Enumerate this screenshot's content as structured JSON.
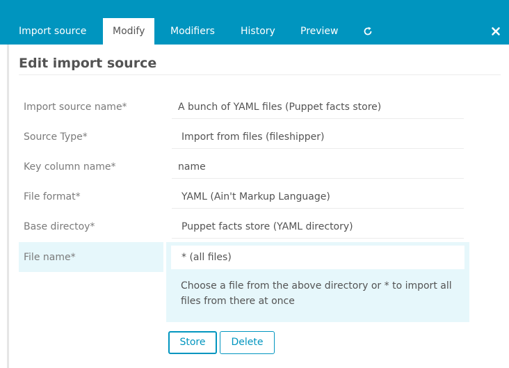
{
  "tabs": [
    {
      "label": "Import source",
      "active": false
    },
    {
      "label": "Modify",
      "active": true
    },
    {
      "label": "Modifiers",
      "active": false
    },
    {
      "label": "History",
      "active": false
    },
    {
      "label": "Preview",
      "active": false
    }
  ],
  "icons": {
    "reload": "reload-icon",
    "close": "close-icon"
  },
  "page_title": "Edit import source",
  "form": {
    "rows": [
      {
        "label": "Import source name*",
        "value": "A bunch of YAML files (Puppet facts store)"
      },
      {
        "label": "Source Type*",
        "value": "Import from files (fileshipper)"
      },
      {
        "label": "Key column name*",
        "value": "name"
      },
      {
        "label": "File format*",
        "value": "YAML (Ain't Markup Language)"
      },
      {
        "label": "Base directoy*",
        "value": "Puppet facts store (YAML directory)"
      },
      {
        "label": "File name*",
        "value": "* (all files)"
      }
    ],
    "hint": "Choose a file from the above directory or * to import all files from there at once"
  },
  "buttons": {
    "store": "Store",
    "delete": "Delete"
  },
  "colors": {
    "accent": "#0095bf",
    "highlight": "#e6f7fb"
  }
}
